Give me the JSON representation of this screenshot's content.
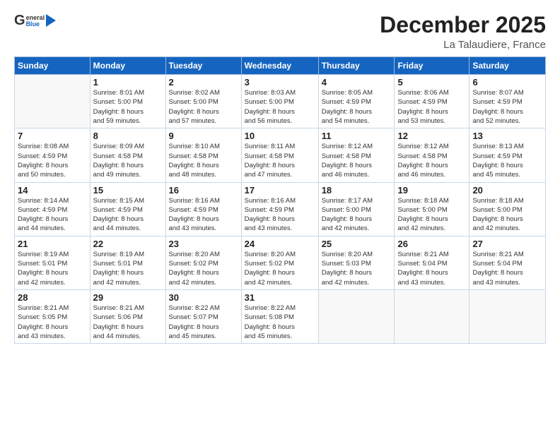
{
  "header": {
    "logo_line1": "General",
    "logo_line2": "Blue",
    "month_title": "December 2025",
    "location": "La Talaudiere, France"
  },
  "calendar": {
    "days_header": [
      "Sunday",
      "Monday",
      "Tuesday",
      "Wednesday",
      "Thursday",
      "Friday",
      "Saturday"
    ],
    "weeks": [
      [
        {
          "day": "",
          "info": ""
        },
        {
          "day": "1",
          "info": "Sunrise: 8:01 AM\nSunset: 5:00 PM\nDaylight: 8 hours\nand 59 minutes."
        },
        {
          "day": "2",
          "info": "Sunrise: 8:02 AM\nSunset: 5:00 PM\nDaylight: 8 hours\nand 57 minutes."
        },
        {
          "day": "3",
          "info": "Sunrise: 8:03 AM\nSunset: 5:00 PM\nDaylight: 8 hours\nand 56 minutes."
        },
        {
          "day": "4",
          "info": "Sunrise: 8:05 AM\nSunset: 4:59 PM\nDaylight: 8 hours\nand 54 minutes."
        },
        {
          "day": "5",
          "info": "Sunrise: 8:06 AM\nSunset: 4:59 PM\nDaylight: 8 hours\nand 53 minutes."
        },
        {
          "day": "6",
          "info": "Sunrise: 8:07 AM\nSunset: 4:59 PM\nDaylight: 8 hours\nand 52 minutes."
        }
      ],
      [
        {
          "day": "7",
          "info": "Sunrise: 8:08 AM\nSunset: 4:59 PM\nDaylight: 8 hours\nand 50 minutes."
        },
        {
          "day": "8",
          "info": "Sunrise: 8:09 AM\nSunset: 4:58 PM\nDaylight: 8 hours\nand 49 minutes."
        },
        {
          "day": "9",
          "info": "Sunrise: 8:10 AM\nSunset: 4:58 PM\nDaylight: 8 hours\nand 48 minutes."
        },
        {
          "day": "10",
          "info": "Sunrise: 8:11 AM\nSunset: 4:58 PM\nDaylight: 8 hours\nand 47 minutes."
        },
        {
          "day": "11",
          "info": "Sunrise: 8:12 AM\nSunset: 4:58 PM\nDaylight: 8 hours\nand 46 minutes."
        },
        {
          "day": "12",
          "info": "Sunrise: 8:12 AM\nSunset: 4:58 PM\nDaylight: 8 hours\nand 46 minutes."
        },
        {
          "day": "13",
          "info": "Sunrise: 8:13 AM\nSunset: 4:59 PM\nDaylight: 8 hours\nand 45 minutes."
        }
      ],
      [
        {
          "day": "14",
          "info": "Sunrise: 8:14 AM\nSunset: 4:59 PM\nDaylight: 8 hours\nand 44 minutes."
        },
        {
          "day": "15",
          "info": "Sunrise: 8:15 AM\nSunset: 4:59 PM\nDaylight: 8 hours\nand 44 minutes."
        },
        {
          "day": "16",
          "info": "Sunrise: 8:16 AM\nSunset: 4:59 PM\nDaylight: 8 hours\nand 43 minutes."
        },
        {
          "day": "17",
          "info": "Sunrise: 8:16 AM\nSunset: 4:59 PM\nDaylight: 8 hours\nand 43 minutes."
        },
        {
          "day": "18",
          "info": "Sunrise: 8:17 AM\nSunset: 5:00 PM\nDaylight: 8 hours\nand 42 minutes."
        },
        {
          "day": "19",
          "info": "Sunrise: 8:18 AM\nSunset: 5:00 PM\nDaylight: 8 hours\nand 42 minutes."
        },
        {
          "day": "20",
          "info": "Sunrise: 8:18 AM\nSunset: 5:00 PM\nDaylight: 8 hours\nand 42 minutes."
        }
      ],
      [
        {
          "day": "21",
          "info": "Sunrise: 8:19 AM\nSunset: 5:01 PM\nDaylight: 8 hours\nand 42 minutes."
        },
        {
          "day": "22",
          "info": "Sunrise: 8:19 AM\nSunset: 5:01 PM\nDaylight: 8 hours\nand 42 minutes."
        },
        {
          "day": "23",
          "info": "Sunrise: 8:20 AM\nSunset: 5:02 PM\nDaylight: 8 hours\nand 42 minutes."
        },
        {
          "day": "24",
          "info": "Sunrise: 8:20 AM\nSunset: 5:02 PM\nDaylight: 8 hours\nand 42 minutes."
        },
        {
          "day": "25",
          "info": "Sunrise: 8:20 AM\nSunset: 5:03 PM\nDaylight: 8 hours\nand 42 minutes."
        },
        {
          "day": "26",
          "info": "Sunrise: 8:21 AM\nSunset: 5:04 PM\nDaylight: 8 hours\nand 43 minutes."
        },
        {
          "day": "27",
          "info": "Sunrise: 8:21 AM\nSunset: 5:04 PM\nDaylight: 8 hours\nand 43 minutes."
        }
      ],
      [
        {
          "day": "28",
          "info": "Sunrise: 8:21 AM\nSunset: 5:05 PM\nDaylight: 8 hours\nand 43 minutes."
        },
        {
          "day": "29",
          "info": "Sunrise: 8:21 AM\nSunset: 5:06 PM\nDaylight: 8 hours\nand 44 minutes."
        },
        {
          "day": "30",
          "info": "Sunrise: 8:22 AM\nSunset: 5:07 PM\nDaylight: 8 hours\nand 45 minutes."
        },
        {
          "day": "31",
          "info": "Sunrise: 8:22 AM\nSunset: 5:08 PM\nDaylight: 8 hours\nand 45 minutes."
        },
        {
          "day": "",
          "info": ""
        },
        {
          "day": "",
          "info": ""
        },
        {
          "day": "",
          "info": ""
        }
      ]
    ]
  }
}
